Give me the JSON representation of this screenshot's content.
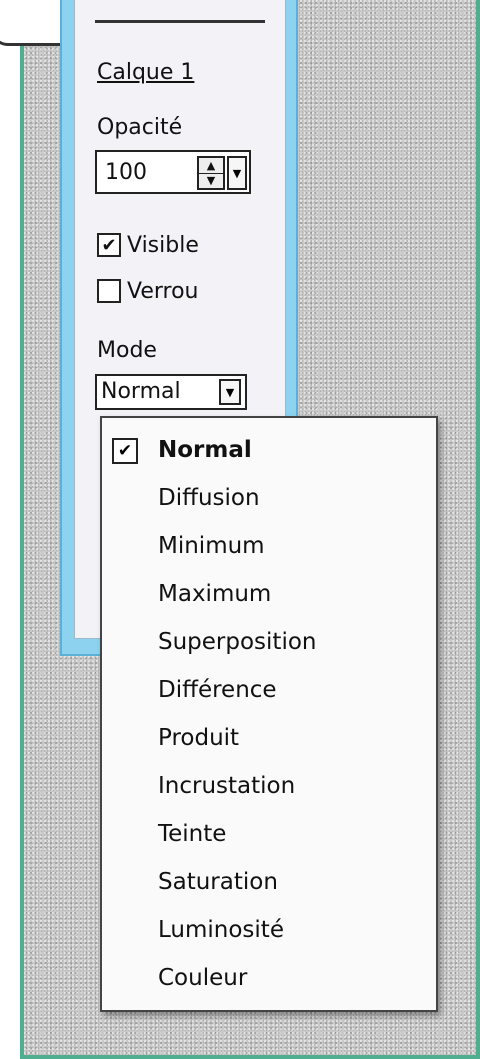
{
  "layer": {
    "name": "Calque 1",
    "opacity_label": "Opacité",
    "opacity_value": "100",
    "visible": {
      "label": "Visible",
      "checked": true
    },
    "lock": {
      "label": "Verrou",
      "checked": false
    },
    "mode_label": "Mode",
    "mode_value": "Normal"
  },
  "menu": {
    "items": [
      {
        "label": "Normal",
        "selected": true
      },
      {
        "label": "Diffusion",
        "selected": false
      },
      {
        "label": "Minimum",
        "selected": false
      },
      {
        "label": "Maximum",
        "selected": false
      },
      {
        "label": "Superposition",
        "selected": false
      },
      {
        "label": "Différence",
        "selected": false
      },
      {
        "label": "Produit",
        "selected": false
      },
      {
        "label": "Incrustation",
        "selected": false
      },
      {
        "label": "Teinte",
        "selected": false
      },
      {
        "label": "Saturation",
        "selected": false
      },
      {
        "label": "Luminosité",
        "selected": false
      },
      {
        "label": "Couleur",
        "selected": false
      }
    ]
  },
  "icons": {
    "spin_up": "triangle-up-icon",
    "spin_down": "triangle-down-icon",
    "dropdown": "chevron-down-icon",
    "check": "checkmark-icon"
  },
  "colors": {
    "frame_border": "#4fae8f",
    "panel_border": "#8dd3ef",
    "panel_bg": "#f3f3f7",
    "texture": "#c9c9c9"
  }
}
